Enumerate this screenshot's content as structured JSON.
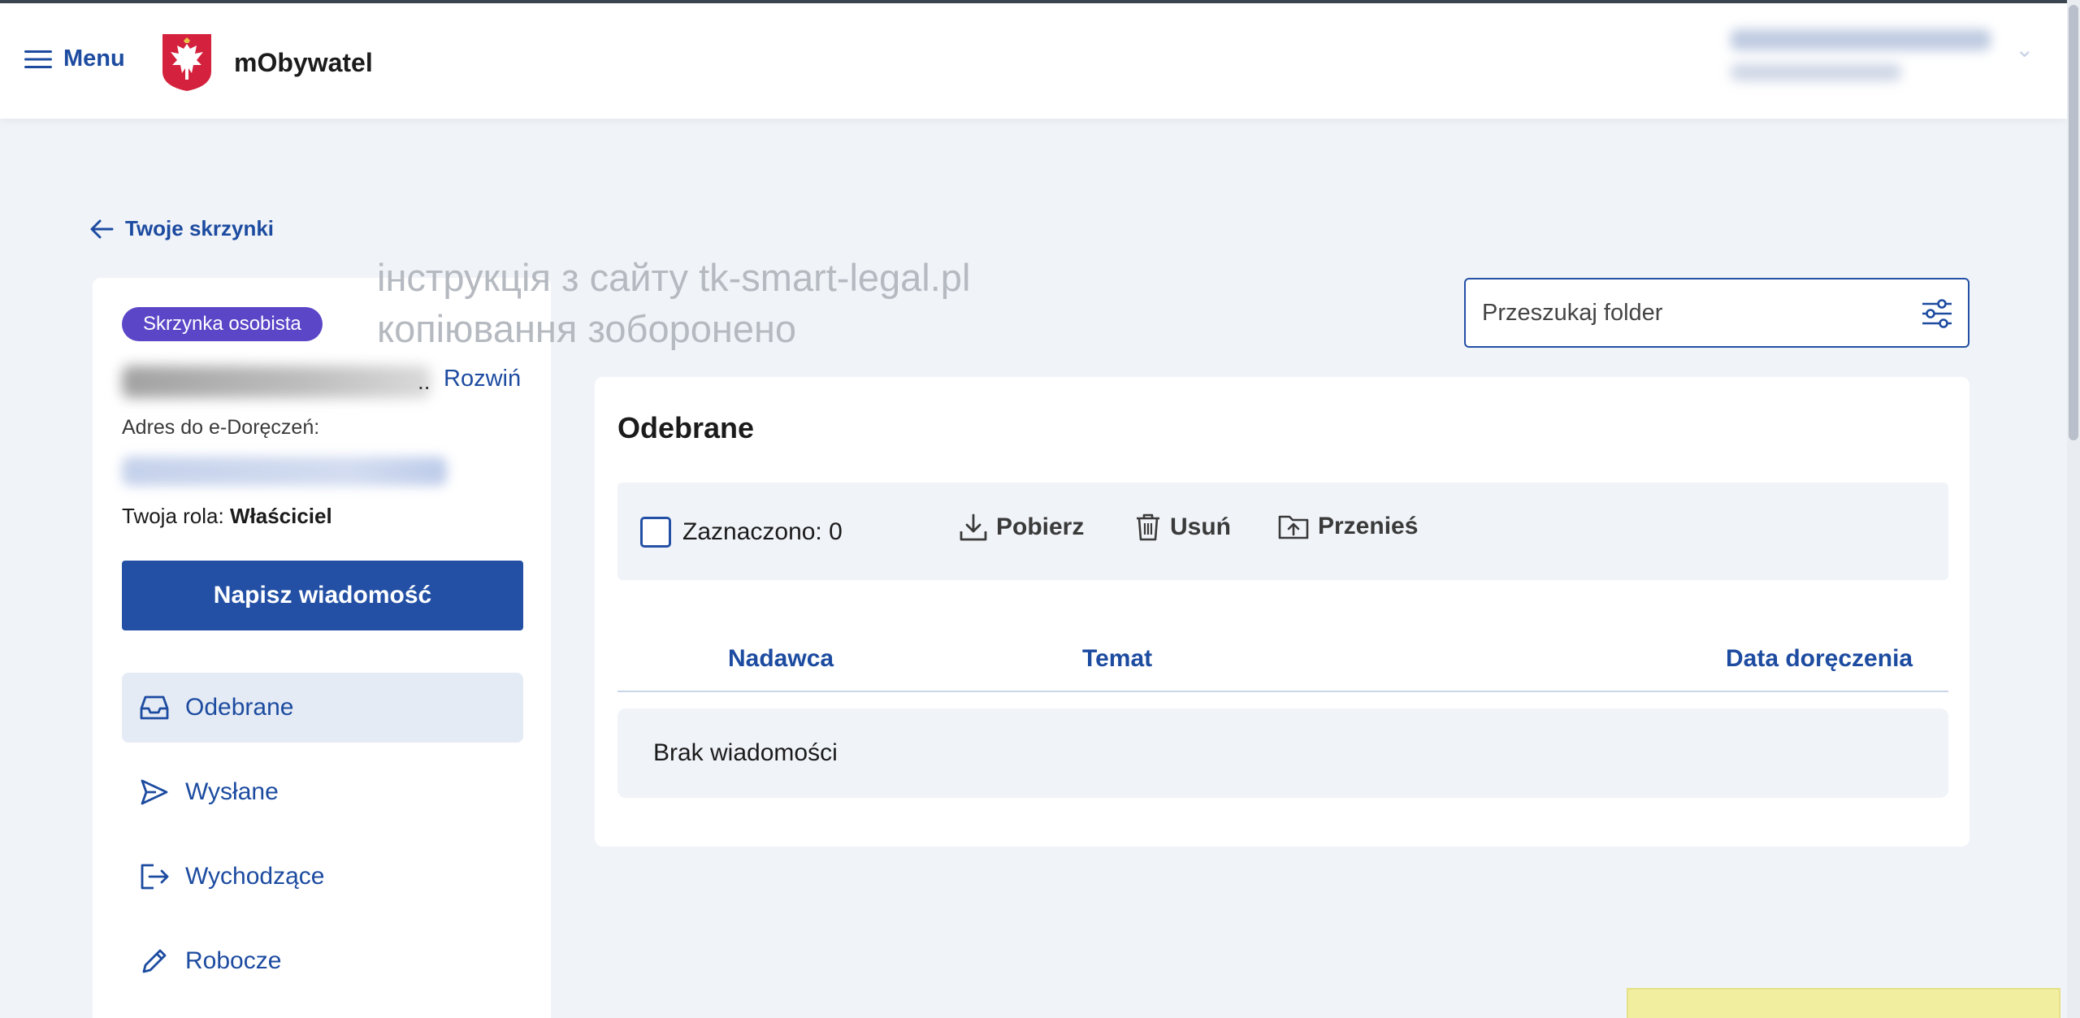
{
  "header": {
    "menu_label": "Menu",
    "app_title": "mObywatel"
  },
  "back_link": {
    "label": "Twoje skrzynki"
  },
  "watermark": {
    "line1": "інструкція з сайту tk-smart-legal.pl",
    "line2": "копіювання зоборонено"
  },
  "sidebar": {
    "badge": "Skrzynka osobista",
    "name_ellipsis": "..",
    "expand_label": "Rozwiń",
    "address_label": "Adres do e-Doręczeń:",
    "role_prefix": "Twoja rola:",
    "role_value": "Właściciel",
    "write_button": "Napisz wiadomość",
    "items": [
      {
        "label": "Odebrane",
        "icon": "inbox-icon"
      },
      {
        "label": "Wysłane",
        "icon": "send-icon"
      },
      {
        "label": "Wychodzące",
        "icon": "outgoing-icon"
      },
      {
        "label": "Robocze",
        "icon": "pencil-icon"
      }
    ]
  },
  "search": {
    "placeholder": "Przeszukaj folder"
  },
  "main": {
    "title": "Odebrane",
    "selected_label": "Zaznaczono: 0",
    "actions": {
      "download": "Pobierz",
      "delete": "Usuń",
      "move": "Przenieś"
    },
    "columns": {
      "sender": "Nadawca",
      "subject": "Temat",
      "date": "Data doręczenia"
    },
    "empty_message": "Brak wiadomości"
  },
  "colors": {
    "accent": "#2350a5",
    "badge": "#5a46c7",
    "page_bg": "#f0f3f8"
  }
}
